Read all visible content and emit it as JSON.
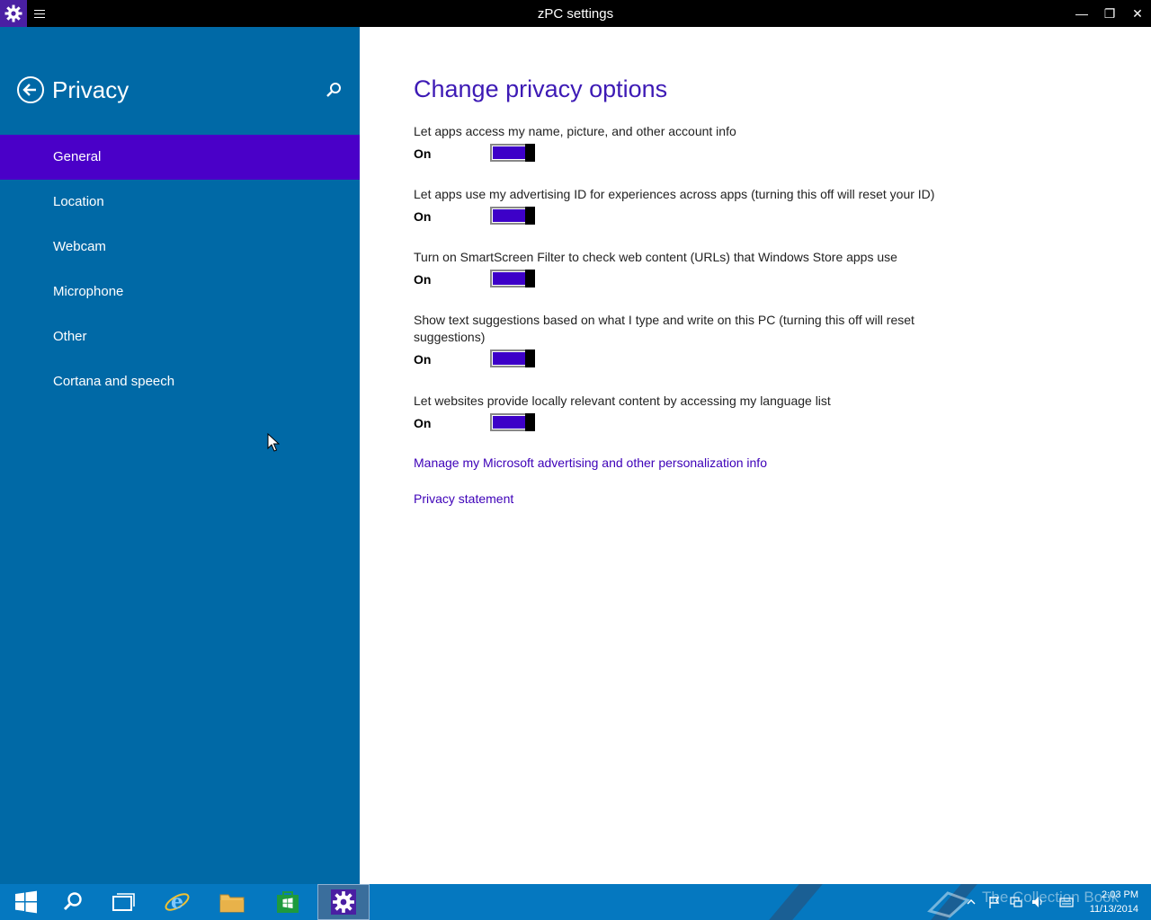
{
  "window": {
    "title": "zPC settings",
    "minimize_glyph": "—",
    "restore_glyph": "❐",
    "close_glyph": "✕"
  },
  "sidebar": {
    "title": "Privacy",
    "items": [
      {
        "label": "General",
        "selected": true
      },
      {
        "label": "Location"
      },
      {
        "label": "Webcam"
      },
      {
        "label": "Microphone"
      },
      {
        "label": "Other"
      },
      {
        "label": "Cortana and speech"
      }
    ]
  },
  "main": {
    "heading": "Change privacy options",
    "settings": [
      {
        "label": "Let apps access my name, picture, and other account info",
        "state": "On"
      },
      {
        "label": "Let apps use my advertising ID for experiences across apps (turning this off will reset your ID)",
        "state": "On"
      },
      {
        "label": "Turn on SmartScreen Filter to check web content (URLs) that Windows Store apps use",
        "state": "On"
      },
      {
        "label": "Show text suggestions based on what I type and write on this PC (turning this off will reset suggestions)",
        "state": "On"
      },
      {
        "label": "Let websites provide locally relevant content by accessing my language list",
        "state": "On"
      }
    ],
    "links": [
      "Manage my Microsoft advertising and other personalization info",
      "Privacy statement"
    ]
  },
  "taskbar": {
    "watermark": "The Collection Book",
    "time": "2:03 PM",
    "date": "11/13/2014"
  },
  "colors": {
    "sidebar_bg": "#0069a6",
    "selected_nav": "#4a00c8",
    "accent": "#3d00c8",
    "heading": "#3d1ab5",
    "taskbar": "#0578c0"
  }
}
